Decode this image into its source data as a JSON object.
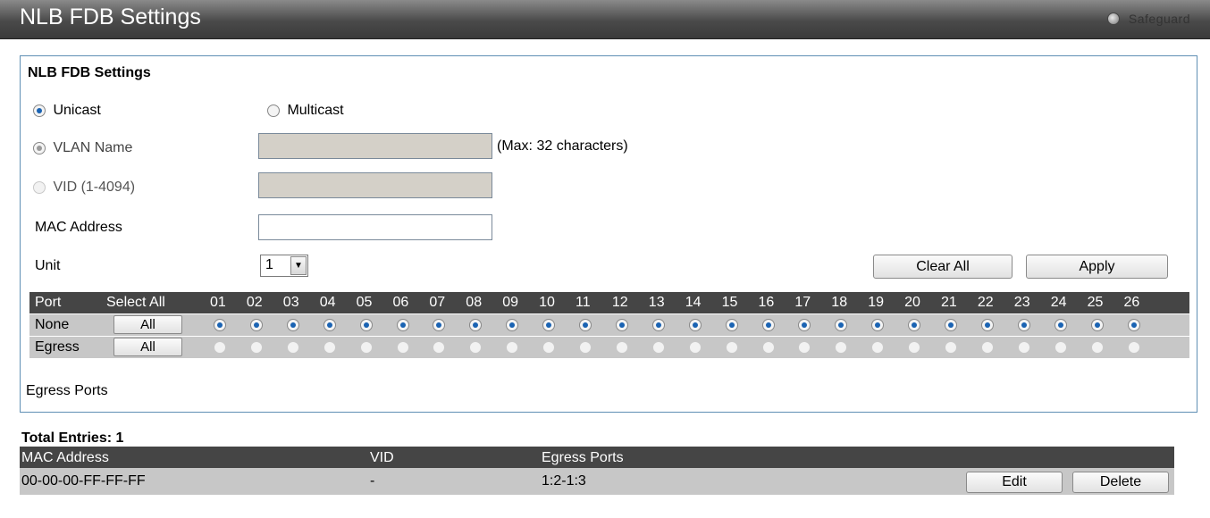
{
  "header": {
    "title": "NLB FDB Settings",
    "safeguard_label": "Safeguard"
  },
  "panel": {
    "heading": "NLB FDB Settings",
    "unicast_label": "Unicast",
    "multicast_label": "Multicast",
    "vlan_name_label": "VLAN Name",
    "vlan_name_value": "",
    "max_note": "(Max: 32 characters)",
    "vid_label": "VID (1-4094)",
    "vid_value": "",
    "mac_label": "MAC Address",
    "mac_value": "",
    "unit_label": "Unit",
    "unit_value": "1",
    "clear_all_label": "Clear All",
    "apply_label": "Apply",
    "egress_ports_label": "Egress Ports"
  },
  "ports": {
    "port_header": "Port",
    "select_all_header": "Select All",
    "numbers": [
      "01",
      "02",
      "03",
      "04",
      "05",
      "06",
      "07",
      "08",
      "09",
      "10",
      "11",
      "12",
      "13",
      "14",
      "15",
      "16",
      "17",
      "18",
      "19",
      "20",
      "21",
      "22",
      "23",
      "24",
      "25",
      "26"
    ],
    "rows": [
      {
        "label": "None",
        "button": "All",
        "selected": true
      },
      {
        "label": "Egress",
        "button": "All",
        "selected": false
      }
    ]
  },
  "results": {
    "total_label": "Total Entries: 1",
    "columns": [
      "MAC Address",
      "VID",
      "Egress Ports"
    ],
    "rows": [
      {
        "mac": "00-00-00-FF-FF-FF",
        "vid": "-",
        "egress": "1:2-1:3",
        "edit": "Edit",
        "delete": "Delete"
      }
    ]
  }
}
